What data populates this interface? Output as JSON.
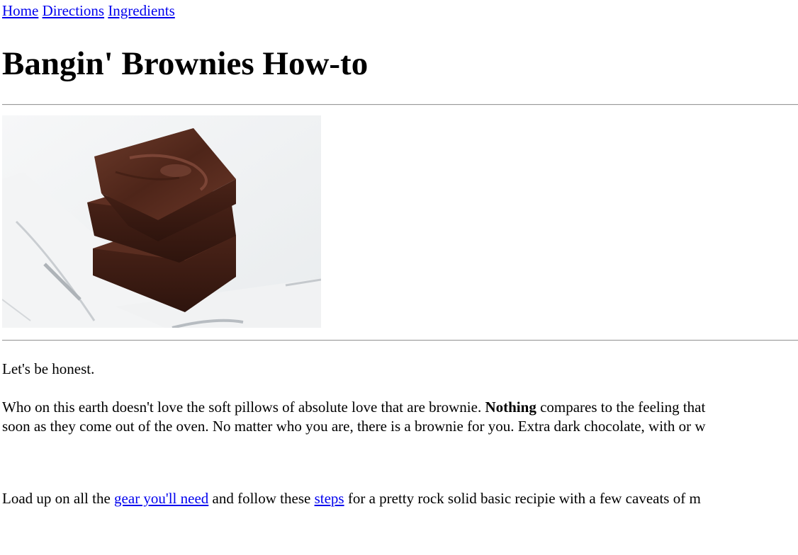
{
  "nav": {
    "home": "Home",
    "directions": "Directions",
    "ingredients": "Ingredients"
  },
  "page_title": "Bangin' Brownies How-to",
  "hero_image": {
    "icon": "brownie-stack-photo",
    "colors": {
      "brownie_dark": "#3a1d14",
      "brownie_mid": "#5a2f22",
      "brownie_light": "#7a4636",
      "marble_bg": "#eef0f1"
    }
  },
  "intro": {
    "line1": "Let's be honest.",
    "para_before_bold": "Who on this earth doesn't love the soft pillows of absolute love that are brownie. ",
    "para_bold": "Nothing",
    "para_after_bold": " compares to the feeling that",
    "para_line2": "soon as they come out of the oven. No matter who you are, there is a brownie for you. Extra dark chocolate, with or w"
  },
  "cta": {
    "before": "Load up on all the ",
    "gear_link": "gear you'll need",
    "middle": " and follow these ",
    "steps_link": "steps",
    "after": " for a pretty rock solid basic recipie with a few caveats of m"
  },
  "colors": {
    "link": "#0000ee",
    "text": "#000000",
    "rule": "#9a9a9a"
  }
}
